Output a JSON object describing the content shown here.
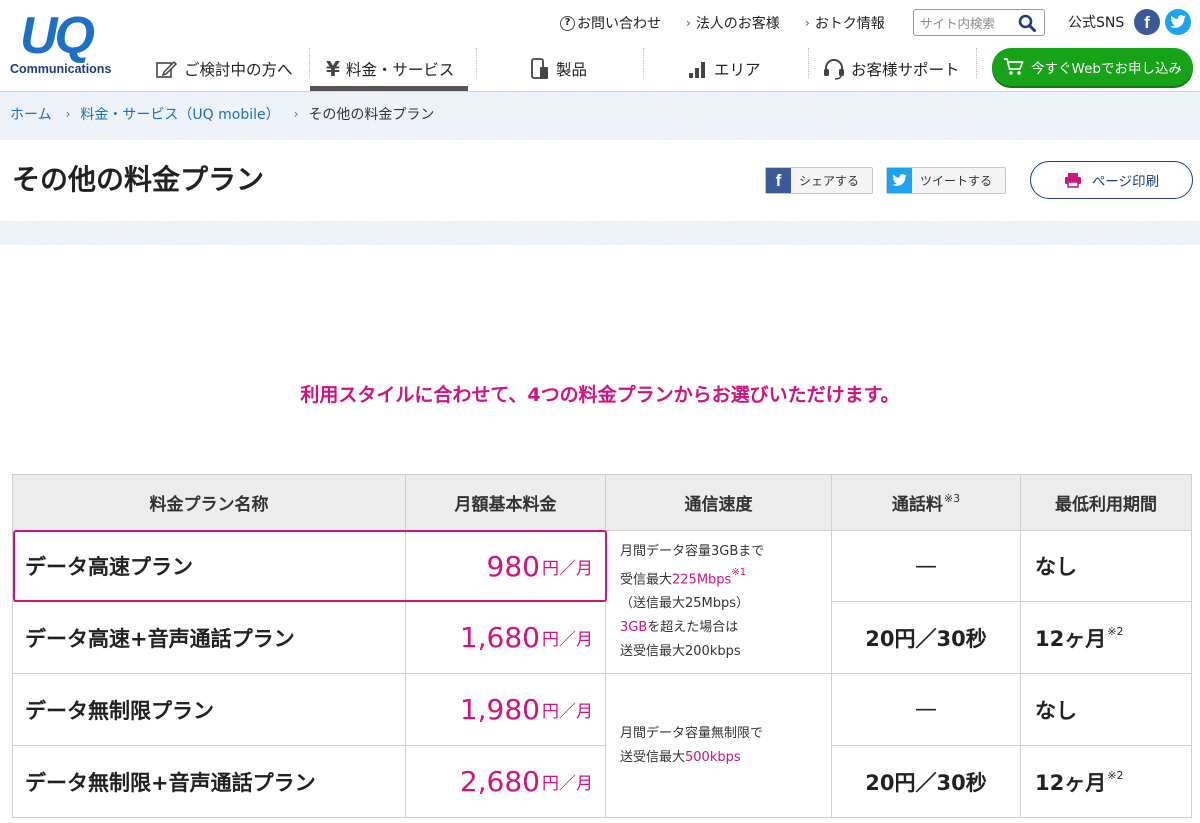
{
  "header": {
    "logo_text": "UQ",
    "logo_sub": "Communications",
    "util": {
      "contact": "お問い合わせ",
      "corporate": "法人のお客様",
      "deals": "おトク情報"
    },
    "search": {
      "placeholder": "サイト内検索"
    },
    "sns_label": "公式SNS",
    "nav": [
      {
        "label": "ご検討中の方へ",
        "icon": "edit-icon"
      },
      {
        "label": "料金・サービス",
        "icon": "yen-icon",
        "active": true
      },
      {
        "label": "製品",
        "icon": "phone-icon"
      },
      {
        "label": "エリア",
        "icon": "signal-icon"
      },
      {
        "label": "お客様サポート",
        "icon": "headset-icon"
      }
    ],
    "apply_label": "今すぐWebでお申し込み"
  },
  "breadcrumb": {
    "items": [
      "ホーム",
      "料金・サービス（UQ mobile）",
      "その他の料金プラン"
    ]
  },
  "page": {
    "title": "その他の料金プラン",
    "share_label": "シェアする",
    "tweet_label": "ツイートする",
    "print_label": "ページ印刷",
    "lead": "利用スタイルに合わせて、4つの料金プランからお選びいただけます。"
  },
  "table": {
    "headers": {
      "plan_name": "料金プラン名称",
      "monthly_fee": "月額基本料金",
      "speed": "通信速度",
      "call_rate": "通話料",
      "call_rate_note": "※3",
      "min_period": "最低利用期間"
    },
    "price_unit": "円／月",
    "rows": [
      {
        "name": "データ高速プラン",
        "price": "980",
        "call": "—",
        "period": "なし",
        "period_note": ""
      },
      {
        "name": "データ高速+音声通話プラン",
        "price": "1,680",
        "call": "20円／30秒",
        "period": "12ヶ月",
        "period_note": "※2"
      },
      {
        "name": "データ無制限プラン",
        "price": "1,980",
        "call": "—",
        "period": "なし",
        "period_note": ""
      },
      {
        "name": "データ無制限+音声通話プラン",
        "price": "2,680",
        "call": "20円／30秒",
        "period": "12ヶ月",
        "period_note": "※2"
      }
    ],
    "speed_high": {
      "line1": "月間データ容量3GBまで",
      "line2_pre": "受信最大",
      "line2_val": "225Mbps",
      "line2_note": "※1",
      "line3": "（送信最大25Mbps）",
      "line4_val": "3GB",
      "line4_post": "を超えた場合は",
      "line5": "送受信最大200kbps"
    },
    "speed_unlimited": {
      "line1": "月間データ容量無制限で",
      "line2_pre": "送受信最大",
      "line2_val": "500kbps"
    }
  },
  "colors": {
    "brand_blue": "#1e6fc8",
    "accent_pink": "#d1127f",
    "apply_green": "#17a317",
    "navy": "#1d3d7a"
  }
}
